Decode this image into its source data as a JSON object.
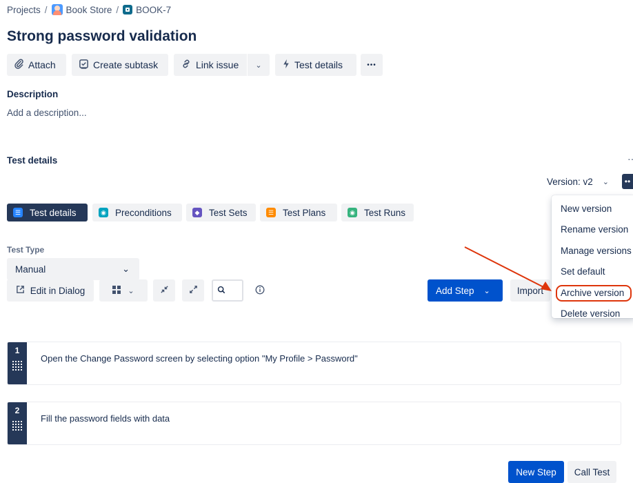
{
  "breadcrumb": {
    "projects": "Projects",
    "separator": "/",
    "project": "Book Store",
    "issue_key": "BOOK-7"
  },
  "issue": {
    "title": "Strong password validation"
  },
  "toolbar": {
    "attach": "Attach",
    "create_subtask": "Create subtask",
    "link_issue": "Link issue",
    "test_details": "Test details",
    "more": "•••"
  },
  "description": {
    "label": "Description",
    "placeholder": "Add a description..."
  },
  "test_details_section": {
    "label": "Test details",
    "version_label": "Version: v2",
    "more": "••"
  },
  "tabs": [
    {
      "label": "Test details",
      "color": "#2684ff"
    },
    {
      "label": "Preconditions",
      "color": "#00a3bf"
    },
    {
      "label": "Test Sets",
      "color": "#6554c0"
    },
    {
      "label": "Test Plans",
      "color": "#ff8b00"
    },
    {
      "label": "Test Runs",
      "color": "#36b37e"
    }
  ],
  "test_type": {
    "label": "Test Type",
    "value": "Manual"
  },
  "steps_toolbar": {
    "edit_in_dialog": "Edit in Dialog",
    "add_step": "Add Step",
    "import": "Import"
  },
  "steps": [
    {
      "number": "1",
      "text": "Open the Change Password screen by selecting option \"My Profile > Password\""
    },
    {
      "number": "2",
      "text": "Fill the password fields with data"
    }
  ],
  "footer": {
    "new_step": "New Step",
    "call_test": "Call Test"
  },
  "version_menu": {
    "items": [
      "New version",
      "Rename version",
      "Manage versions",
      "Set default",
      "Archive version",
      "Delete version"
    ],
    "highlighted_item": "Archive version"
  },
  "colors": {
    "primary": "#0052cc",
    "dark": "#253858",
    "annotation": "#de350b"
  }
}
